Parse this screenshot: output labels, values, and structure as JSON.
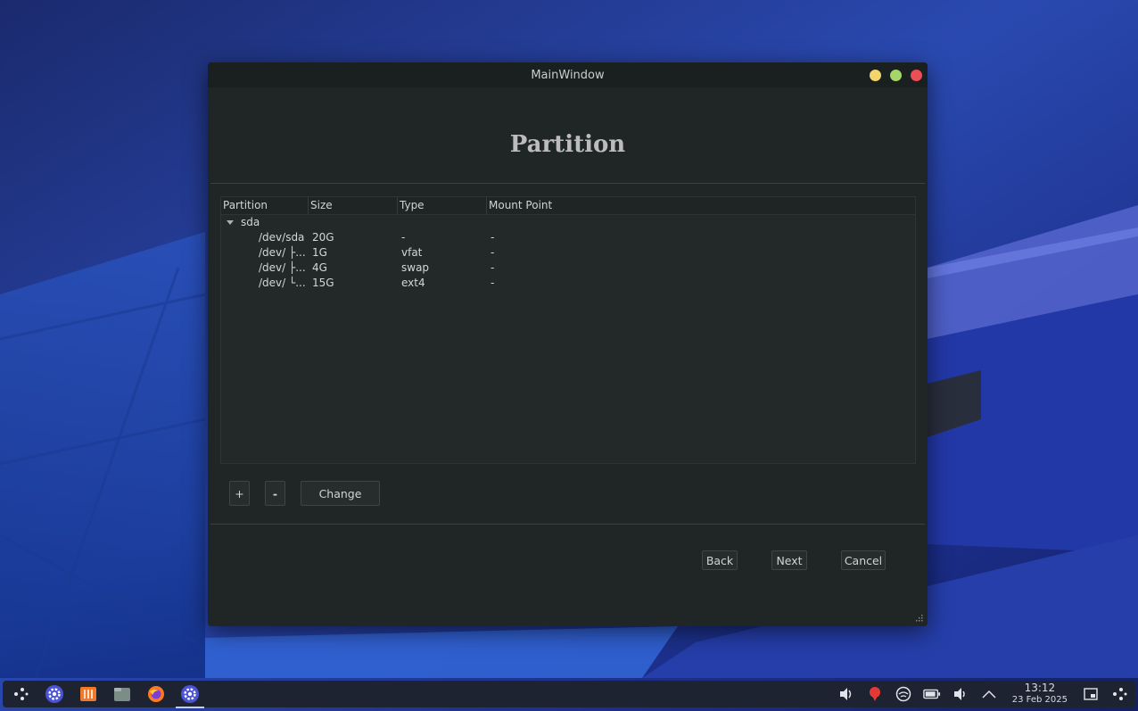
{
  "window": {
    "title": "MainWindow"
  },
  "page": {
    "title": "Partition"
  },
  "tree": {
    "headers": [
      "Partition",
      "Size",
      "Type",
      "Mount Point"
    ],
    "disk": "sda",
    "rows": [
      {
        "partition": "/dev/sda",
        "size": "20G",
        "type": "-",
        "mount": "-"
      },
      {
        "partition": "/dev/ ├...",
        "size": "1G",
        "type": "vfat",
        "mount": "-"
      },
      {
        "partition": "/dev/ ├...",
        "size": "4G",
        "type": "swap",
        "mount": "-"
      },
      {
        "partition": "/dev/ └...",
        "size": "15G",
        "type": "ext4",
        "mount": "-"
      }
    ]
  },
  "actions": {
    "add": "+",
    "remove": "-",
    "change": "Change"
  },
  "nav": {
    "back": "Back",
    "next": "Next",
    "cancel": "Cancel"
  },
  "taskbar": {
    "apps": [
      "app-launcher-icon",
      "settings-icon",
      "package-manager-icon",
      "file-manager-icon",
      "firefox-icon",
      "installer-icon"
    ],
    "tray": [
      "audio-icon",
      "notification-icon",
      "network-icon",
      "battery-icon",
      "volume-icon",
      "tray-expand-icon"
    ],
    "time": "13:12",
    "date": "23 Feb 2025"
  },
  "colors": {
    "accent": "#3b6fd1",
    "window_bg": "#202626",
    "close": "#ec4e56",
    "minimize": "#f3d56b",
    "maximize": "#a6d66a"
  }
}
